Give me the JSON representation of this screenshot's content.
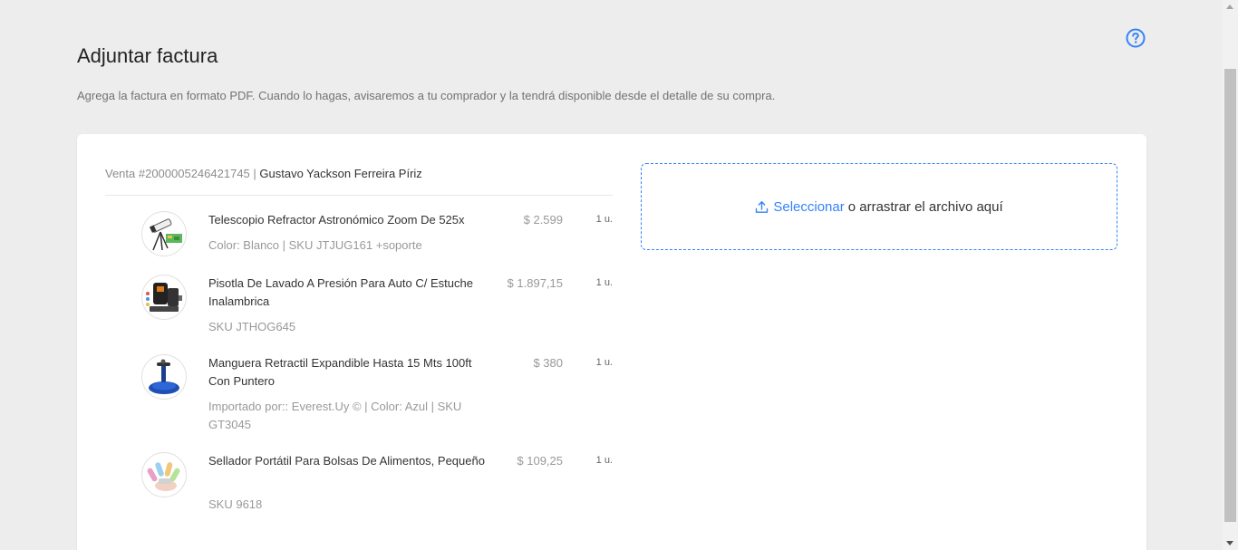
{
  "header": {
    "title": "Adjuntar factura",
    "subtitle": "Agrega la factura en formato PDF. Cuando lo hagas, avisaremos a tu comprador y la tendrá disponible desde el detalle de su compra.",
    "help_icon": "question-circle-icon"
  },
  "sale": {
    "number": "Venta #2000005246421745",
    "separator": " | ",
    "buyer": "Gustavo Yackson Ferreira Píriz"
  },
  "items": [
    {
      "name": "Telescopio Refractor Astronómico Zoom De 525x",
      "meta": "Color: Blanco | SKU JTJUG161 +soporte",
      "price": "$ 2.599",
      "qty": "1 u.",
      "icon": "telescope-image"
    },
    {
      "name": "Pisotla De Lavado A Presión Para Auto C/ Estuche Inalambrica",
      "meta": "SKU JTHOG645",
      "price": "$ 1.897,15",
      "qty": "1 u.",
      "icon": "pressure-washer-image"
    },
    {
      "name": "Manguera Retractil Expandible Hasta 15 Mts 100ft Con Puntero",
      "meta": "Importado por:: Everest.Uy © | Color: Azul | SKU GT3045",
      "price": "$ 380",
      "qty": "1 u.",
      "icon": "hose-image"
    },
    {
      "name": "Sellador Portátil Para Bolsas De Alimentos, Pequeño",
      "meta": "SKU 9618",
      "price": "$ 109,25",
      "qty": "1 u.",
      "icon": "bag-sealer-image"
    }
  ],
  "dropzone": {
    "select_label": "Seleccionar",
    "rest_label": "o arrastrar el archivo aquí",
    "icon": "upload-icon"
  },
  "colors": {
    "accent": "#3483fa",
    "background": "#ededed",
    "card": "#ffffff"
  }
}
